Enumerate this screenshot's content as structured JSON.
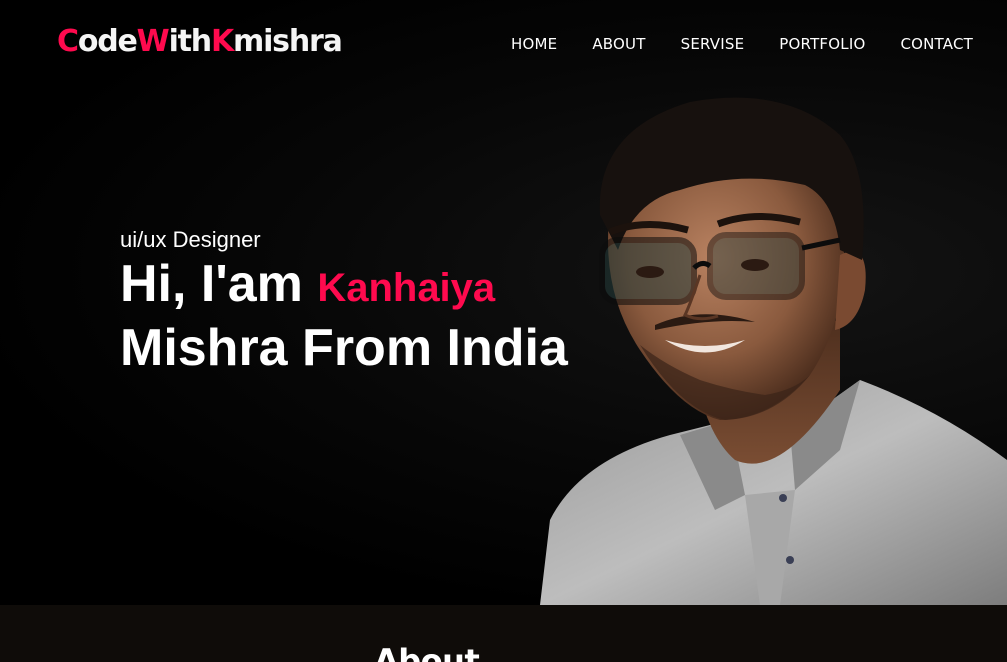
{
  "navbar": {
    "logo": {
      "part1_accent": "C",
      "part1_rest": "ode",
      "part2_accent": "W",
      "part2_rest": "ith",
      "part3_accent": "K",
      "part3_rest": "mishra"
    },
    "links": [
      "HOME",
      "ABOUT",
      "SERVISE",
      "PORTFOLIO",
      "CONTACT"
    ]
  },
  "hero": {
    "role": "ui/ux Designer",
    "greeting": "Hi, I'am ",
    "name_first": "Kanhaiya",
    "line2": "Mishra From India"
  },
  "about": {
    "title": "About"
  },
  "colors": {
    "accent": "#ff0a4e",
    "background": "#000000",
    "text": "#ffffff",
    "strip": "#0f0c09"
  }
}
